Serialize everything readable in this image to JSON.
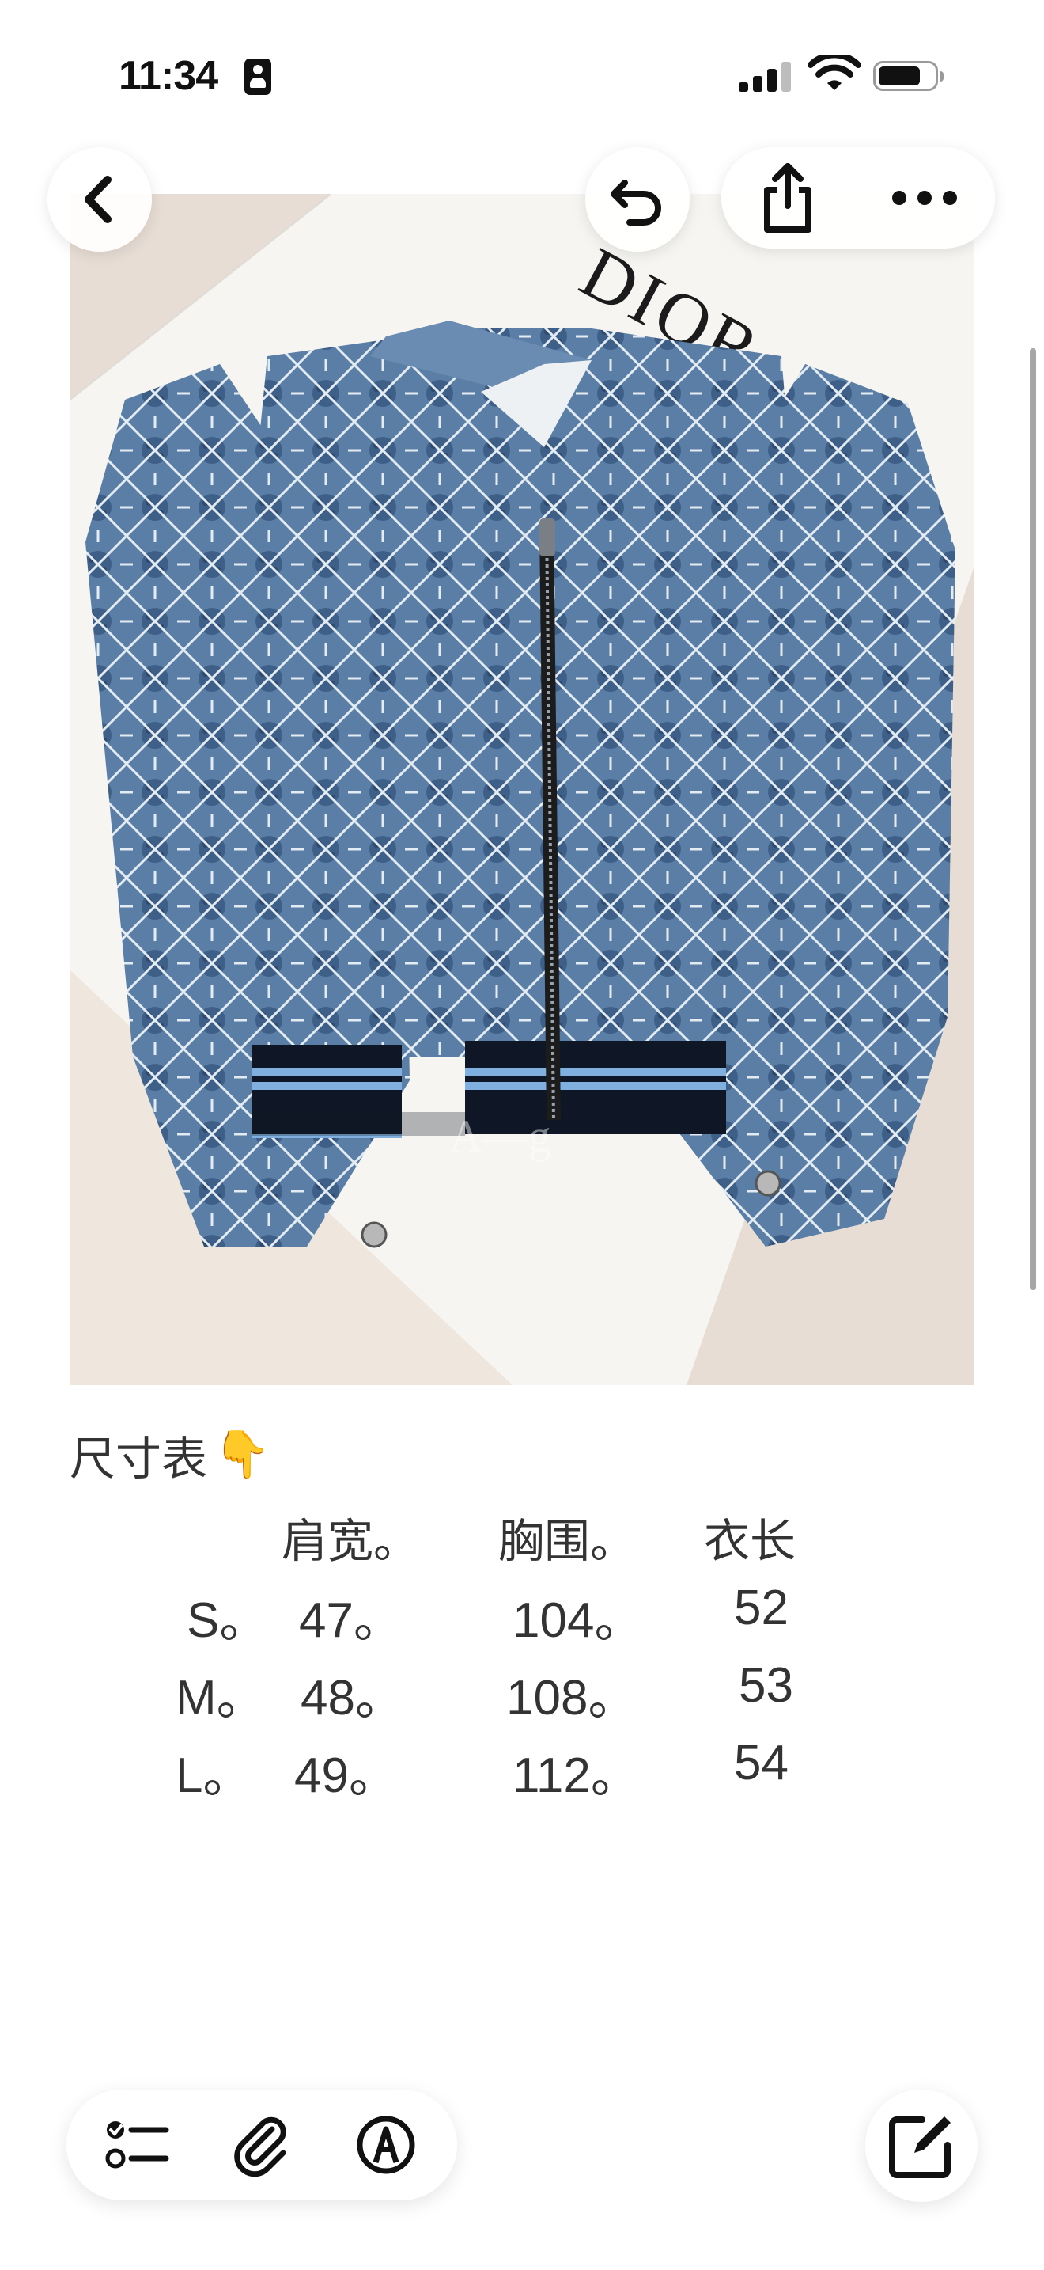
{
  "status_bar": {
    "time": "11:34",
    "signal_bars": 3,
    "battery_level": 0.7
  },
  "nav": {
    "back_icon": "chevron-left-icon",
    "undo_icon": "undo-icon",
    "share_icon": "share-icon",
    "more_icon": "ellipsis-icon"
  },
  "photo": {
    "brand_text": "DIOR",
    "watermark": "A—g"
  },
  "note": {
    "title": "尺寸表",
    "title_emoji": "👇",
    "headers": [
      "肩宽。",
      "胸围。",
      "衣长"
    ],
    "rows": [
      {
        "size": "S。",
        "shoulder": "47。",
        "chest": "104。",
        "length": "52"
      },
      {
        "size": "M。",
        "shoulder": "48。",
        "chest": "108。",
        "length": "53"
      },
      {
        "size": "L。",
        "shoulder": "49。",
        "chest": "112。",
        "length": "54"
      }
    ]
  },
  "toolbar": {
    "checklist_icon": "checklist-icon",
    "attachment_icon": "paperclip-icon",
    "markup_icon": "markup-pen-icon",
    "compose_icon": "compose-icon"
  },
  "colors": {
    "text": "#333333",
    "denim": "#5b7ea6",
    "rib_light": "#7fb0e0",
    "rib_dark": "#0f1726"
  }
}
